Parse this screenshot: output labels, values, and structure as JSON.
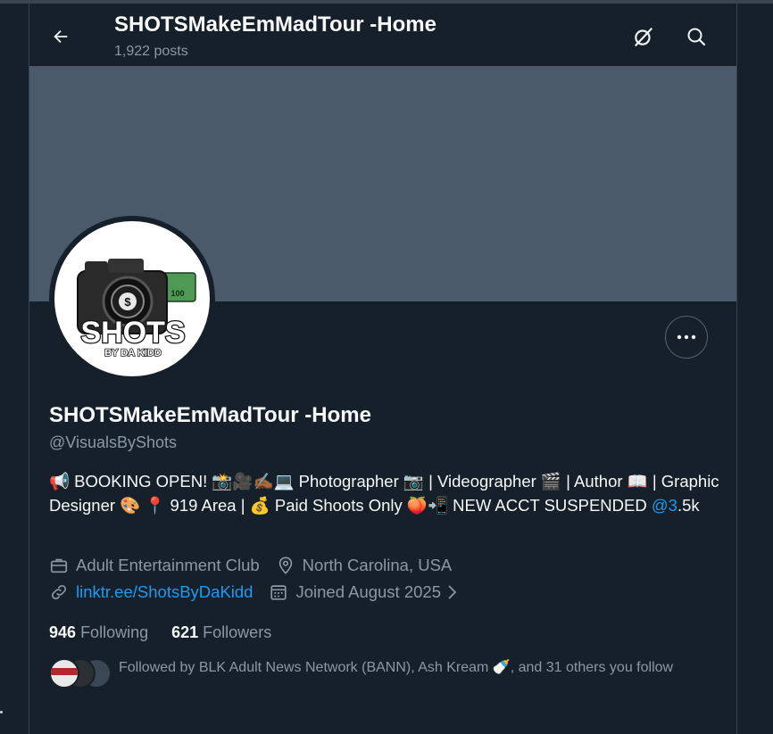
{
  "header": {
    "title": "SHOTSMakeEmMadTour -Home",
    "posts_count": "1,922 posts"
  },
  "profile": {
    "display_name": "SHOTSMakeEmMadTour -Home",
    "handle": "@VisualsByShots",
    "bio_part1": "📢 BOOKING OPEN! 📸🎥✍🏾💻 Photographer 📷 | Videographer 🎬 | Author 📖 | Graphic Designer 🎨 📍 919 Area | 💰 Paid Shoots Only 🍑📲 NEW ACCT SUSPENDED ",
    "bio_mention": "@3",
    "bio_part2": ".5k",
    "category": "Adult Entertainment Club",
    "location": "North Carolina, USA",
    "website": "linktr.ee/ShotsByDaKidd",
    "joined": "Joined August 2025"
  },
  "avatar_logo": {
    "line1": "SHOTS",
    "line2": "BY DA KIDD"
  },
  "stats": {
    "following_count": "946",
    "following_label": "Following",
    "followers_count": "621",
    "followers_label": "Followers"
  },
  "followed_by": {
    "text": "Followed by BLK Adult News Network (BANN), Ash Kream 🍼, and 31 others you follow"
  },
  "colors": {
    "background": "#15202b",
    "banner": "#4b5a6b",
    "accent": "#1d9bf0",
    "secondary_text": "#8b98a5"
  },
  "icons": [
    "back-arrow-icon",
    "grok-icon",
    "search-icon",
    "more-icon",
    "briefcase-icon",
    "location-pin-icon",
    "link-icon",
    "calendar-icon",
    "chevron-right-icon"
  ]
}
